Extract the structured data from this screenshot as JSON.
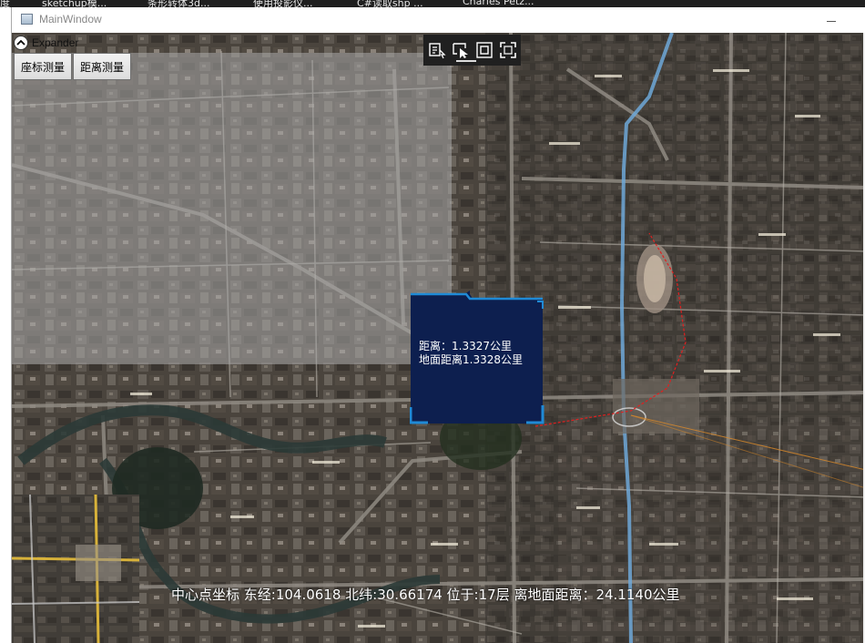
{
  "taskbar": {
    "items": [
      "度",
      "sketchup模...",
      "条形转体3d...",
      "使用投影仪...",
      "C#读取shp ...",
      "Charles Petz..."
    ]
  },
  "window": {
    "title": "MainWindow"
  },
  "expander": {
    "label": "Expander"
  },
  "toolbar": {
    "coord_label": "座标测量",
    "distance_label": "距离测量"
  },
  "map_tools": {
    "icons": [
      "measure-tool-icon",
      "pointer-select-icon",
      "frame-icon",
      "fullscreen-icon"
    ]
  },
  "popup": {
    "distance": "距离：1.3327公里",
    "ground_distance": "地面距离1.3328公里"
  },
  "status": {
    "text": "中心点坐标 东经:104.0618 北纬:30.66174 位于:17层 离地面距离：24.1140公里"
  },
  "colors": {
    "popup_bg": "#0d1f4f",
    "popup_border": "#1f8ad6",
    "measure_line": "#e02020"
  }
}
